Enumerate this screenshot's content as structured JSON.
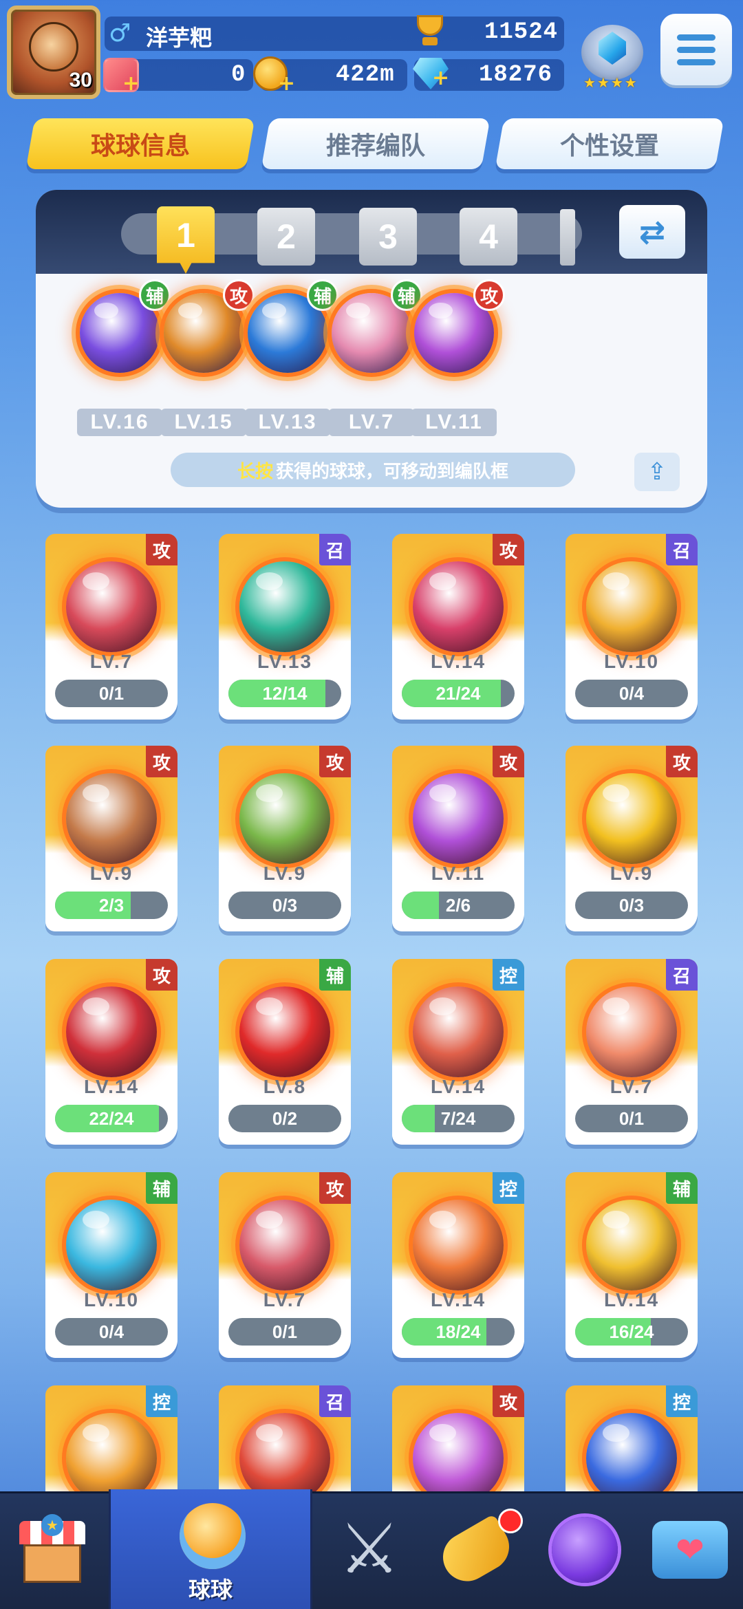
{
  "player": {
    "name": "洋芋粑",
    "gender_symbol": "♂",
    "avatar_level": "30",
    "trophies": "11524",
    "tickets": "0",
    "distance": "422m",
    "gems": "18276"
  },
  "tabs": [
    {
      "label": "球球信息",
      "active": true
    },
    {
      "label": "推荐编队",
      "active": false
    },
    {
      "label": "个性设置",
      "active": false
    }
  ],
  "team": {
    "slots": [
      "1",
      "2",
      "3",
      "4"
    ],
    "active_slot": 0,
    "balls": [
      {
        "role": "辅",
        "level": "LV.16",
        "role_color": "#3aa844",
        "color": "#7a4ee0"
      },
      {
        "role": "攻",
        "level": "LV.15",
        "role_color": "#d83a2e",
        "color": "#e08a2a"
      },
      {
        "role": "辅",
        "level": "LV.13",
        "role_color": "#3aa844",
        "color": "#2c7ad8"
      },
      {
        "role": "辅",
        "level": "LV.7",
        "role_color": "#3aa844",
        "color": "#e58ab0"
      },
      {
        "role": "攻",
        "level": "LV.11",
        "role_color": "#d83a2e",
        "color": "#b050d8"
      }
    ],
    "hint_key": "长按",
    "hint_text": "获得的球球，可移动到编队框"
  },
  "collection": [
    {
      "role": "攻",
      "role_color": "#c63a2e",
      "level": "LV.7",
      "progress": "0/1",
      "fill": 0,
      "color": "#d84a5a"
    },
    {
      "role": "召",
      "role_color": "#6a52d8",
      "level": "LV.13",
      "progress": "12/14",
      "fill": 0.86,
      "color": "#2fb89a"
    },
    {
      "role": "攻",
      "role_color": "#c63a2e",
      "level": "LV.14",
      "progress": "21/24",
      "fill": 0.875,
      "color": "#d8406a"
    },
    {
      "role": "召",
      "role_color": "#6a52d8",
      "level": "LV.10",
      "progress": "0/4",
      "fill": 0,
      "color": "#f0b030"
    },
    {
      "role": "攻",
      "role_color": "#c63a2e",
      "level": "LV.9",
      "progress": "2/3",
      "fill": 0.67,
      "color": "#c47a4a"
    },
    {
      "role": "攻",
      "role_color": "#c63a2e",
      "level": "LV.9",
      "progress": "0/3",
      "fill": 0,
      "color": "#7ab84a"
    },
    {
      "role": "攻",
      "role_color": "#c63a2e",
      "level": "LV.11",
      "progress": "2/6",
      "fill": 0.33,
      "color": "#b050d8"
    },
    {
      "role": "攻",
      "role_color": "#c63a2e",
      "level": "LV.9",
      "progress": "0/3",
      "fill": 0,
      "color": "#f2c020"
    },
    {
      "role": "攻",
      "role_color": "#c63a2e",
      "level": "LV.14",
      "progress": "22/24",
      "fill": 0.92,
      "color": "#d0303a"
    },
    {
      "role": "辅",
      "role_color": "#3aa844",
      "level": "LV.8",
      "progress": "0/2",
      "fill": 0,
      "color": "#e02a2a"
    },
    {
      "role": "控",
      "role_color": "#3a9ad8",
      "level": "LV.14",
      "progress": "7/24",
      "fill": 0.29,
      "color": "#e0604a"
    },
    {
      "role": "召",
      "role_color": "#6a52d8",
      "level": "LV.7",
      "progress": "0/1",
      "fill": 0,
      "color": "#f08a6a"
    },
    {
      "role": "辅",
      "role_color": "#3aa844",
      "level": "LV.10",
      "progress": "0/4",
      "fill": 0,
      "color": "#3ab8e0"
    },
    {
      "role": "攻",
      "role_color": "#c63a2e",
      "level": "LV.7",
      "progress": "0/1",
      "fill": 0,
      "color": "#d85a6a"
    },
    {
      "role": "控",
      "role_color": "#3a9ad8",
      "level": "LV.14",
      "progress": "18/24",
      "fill": 0.75,
      "color": "#f07a3a"
    },
    {
      "role": "辅",
      "role_color": "#3aa844",
      "level": "LV.14",
      "progress": "16/24",
      "fill": 0.67,
      "color": "#f0c030"
    },
    {
      "role": "控",
      "role_color": "#3a9ad8",
      "color": "#f0a030"
    },
    {
      "role": "召",
      "role_color": "#6a52d8",
      "color": "#e04a3a"
    },
    {
      "role": "攻",
      "role_color": "#c63a2e",
      "color": "#c05ad8"
    },
    {
      "role": "控",
      "role_color": "#3a9ad8",
      "color": "#3a6ae0"
    }
  ],
  "bottom_nav": [
    {
      "label": "",
      "icon": "shop-icon",
      "active": false
    },
    {
      "label": "球球",
      "icon": "ball-icon",
      "active": true
    },
    {
      "label": "",
      "icon": "crossed-swords-icon",
      "active": false
    },
    {
      "label": "",
      "icon": "whistle-icon",
      "active": false,
      "badge": true
    },
    {
      "label": "",
      "icon": "planet-icon",
      "active": false
    },
    {
      "label": "",
      "icon": "chat-heart-icon",
      "active": false
    }
  ]
}
